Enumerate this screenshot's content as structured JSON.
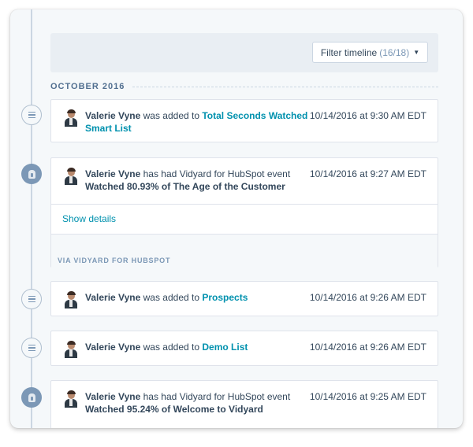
{
  "filter": {
    "label": "Filter timeline",
    "count": "(16/18)",
    "caret_icon": "caret-down-icon"
  },
  "timeline": {
    "month": "OCTOBER 2016",
    "items": [
      {
        "type": "list",
        "name": "Valerie Vyne",
        "action": "was added to",
        "target": "Total Seconds Watched Smart List",
        "time": "10/14/2016 at 9:30 AM EDT"
      },
      {
        "type": "event",
        "name": "Valerie Vyne",
        "action": "has had Vidyard for HubSpot event",
        "detail": "Watched 80.93% of The Age of the Customer",
        "time": "10/14/2016 at 9:27 AM EDT",
        "show_details": "Show details",
        "via": "VIA VIDYARD FOR HUBSPOT"
      },
      {
        "type": "list",
        "name": "Valerie Vyne",
        "action": "was added to",
        "target": "Prospects",
        "time": "10/14/2016 at 9:26 AM EDT"
      },
      {
        "type": "list",
        "name": "Valerie Vyne",
        "action": "was added to",
        "target": "Demo List",
        "time": "10/14/2016 at 9:26 AM EDT"
      },
      {
        "type": "event",
        "name": "Valerie Vyne",
        "action": "has had Vidyard for HubSpot event",
        "detail": "Watched 95.24% of Welcome to Vidyard",
        "time": "10/14/2016 at 9:25 AM EDT"
      }
    ]
  },
  "colors": {
    "link": "#0091ae",
    "text": "#33475b",
    "muted": "#7c98b6",
    "border": "#dfe3eb"
  }
}
